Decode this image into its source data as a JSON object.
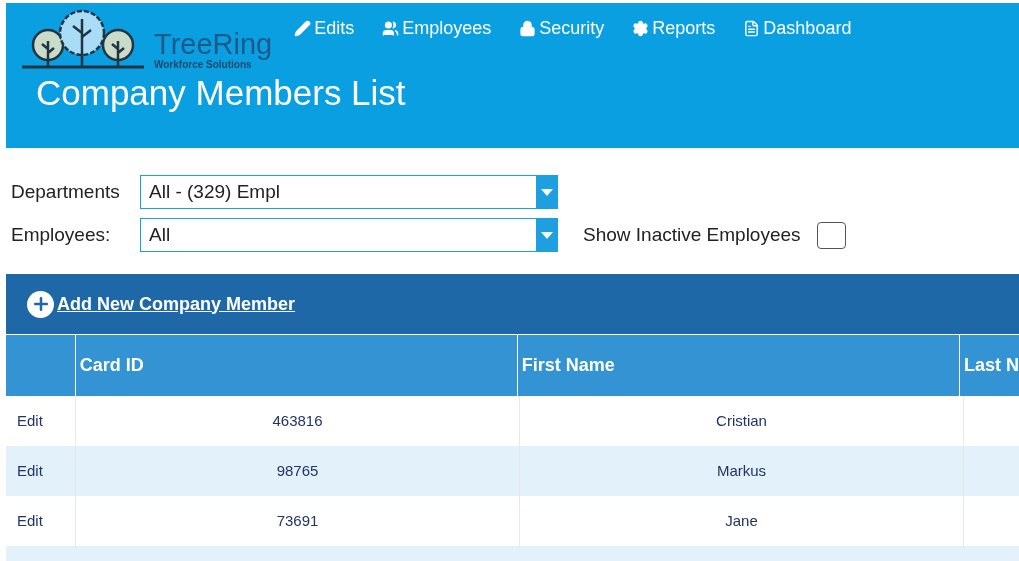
{
  "header": {
    "logo": {
      "name": "TreeRing",
      "tagline": "Workforce Solutions"
    },
    "nav": [
      {
        "kind": "pencil",
        "label": "Edits"
      },
      {
        "kind": "users",
        "label": "Employees"
      },
      {
        "kind": "lock",
        "label": "Security"
      },
      {
        "kind": "gear",
        "label": "Reports"
      },
      {
        "kind": "doc",
        "label": "Dashboard"
      }
    ],
    "title": "Company Members List"
  },
  "filters": {
    "departments": {
      "label": "Departments",
      "value": "All - (329) Empl"
    },
    "employees": {
      "label": "Employees:",
      "value": "All"
    },
    "show_inactive": {
      "label": "Show Inactive Employees",
      "checked": false
    }
  },
  "add_link": "Add New Company Member",
  "table": {
    "columns": [
      "Card ID",
      "First Name",
      "Last N"
    ],
    "rows": [
      {
        "action": "Edit",
        "card_id": "463816",
        "first_name": "Cristian"
      },
      {
        "action": "Edit",
        "card_id": "98765",
        "first_name": "Markus"
      },
      {
        "action": "Edit",
        "card_id": "73691",
        "first_name": "Jane"
      }
    ]
  }
}
